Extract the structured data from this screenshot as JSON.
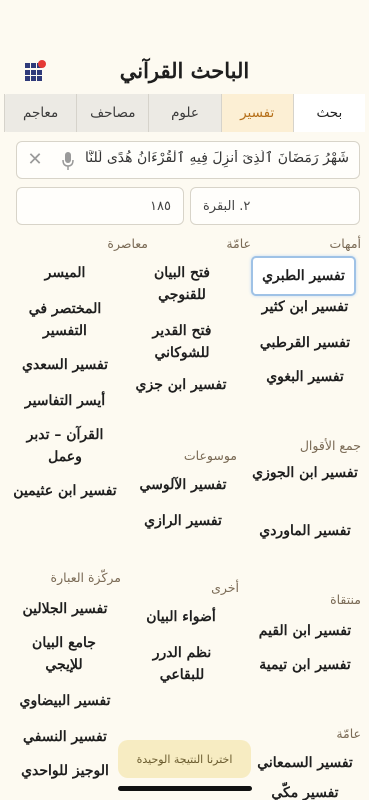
{
  "app": {
    "title": "الباحث القرآني"
  },
  "tabs": [
    {
      "label": "بحث"
    },
    {
      "label": "تفسير"
    },
    {
      "label": "علوم"
    },
    {
      "label": "مصاحف"
    },
    {
      "label": "معاجم"
    }
  ],
  "search": {
    "value": "شَهْرُ رَمَضَانَ ٱلَّذِىٓ أُنزِلَ فِيهِ ٱلْقُرْءَانُ هُدًى لِّلنَّاسِ وَبَيِّنَٰتٍ"
  },
  "selectors": {
    "surah": "٢. البقرة",
    "ayah": "١٨٥"
  },
  "categories": {
    "ummahat": "أمهات",
    "aamma1": "عامّة",
    "muasira": "معاصرة",
    "jam_aqwal": "جمع الأقوال",
    "mawsuat": "موسوعات",
    "muntaqa": "منتقاة",
    "ukhra": "أخرى",
    "murakkaza": "مركّزة العبارة",
    "aamma2": "عامّة"
  },
  "items": {
    "tabari": "تفسير الطبري",
    "ibn_kathir": "تفسير ابن كثير",
    "qurtubi": "تفسير القرطبي",
    "baghawi": "تفسير البغوي",
    "fath_bayan": "فتح البيان للقنوجي",
    "fath_qadir": "فتح القدير للشوكاني",
    "ibn_juzay": "تفسير ابن جزي",
    "muyassar": "الميسر",
    "mukhtasar": "المختصر في التفسير",
    "saadi": "تفسير السعدي",
    "aysar": "أيسر التفاسير",
    "quran_tadabbur": "القرآن – تدبر وعمل",
    "uthaymin": "تفسير ابن عثيمين",
    "ibn_jawzi": "تفسير ابن الجوزي",
    "mawardi": "تفسير الماوردي",
    "alusi": "تفسير الآلوسي",
    "razi": "تفسير الرازي",
    "ibn_qayyim": "تفسير ابن القيم",
    "ibn_taymiyya": "تفسير ابن تيمية",
    "adwa": "أضواء البيان",
    "nazm_durar": "نظم الدرر للبقاعي",
    "jalalayn": "تفسير الجلالين",
    "jami_bayan": "جامع البيان للإيجي",
    "baydawi": "تفسير البيضاوي",
    "nasafi": "تفسير النسفي",
    "wajiz": "الوجيز للواحدي",
    "samani": "تفسير السمعاني",
    "makki": "تفسير مكّي"
  },
  "toast": "اخترنا النتيجة الوحيدة",
  "colors": {
    "accent": "#b6701a",
    "background": "#fdfaf1",
    "toast": "#f7ecc2"
  },
  "icons": [
    "grid-menu-icon",
    "microphone-icon",
    "close-icon"
  ]
}
